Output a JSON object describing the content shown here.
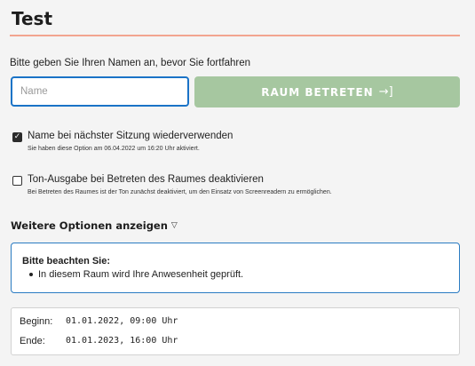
{
  "page": {
    "title": "Test",
    "intro": "Bitte geben Sie Ihren Namen an, bevor Sie fortfahren",
    "accent_color": "#f2a48f"
  },
  "name_input": {
    "placeholder": "Name",
    "value": ""
  },
  "enter_button": {
    "label": "RAUM BETRETEN",
    "icon": "login-arrow-icon",
    "color": "#a6c7a0"
  },
  "options": [
    {
      "label": "Name bei nächster Sitzung wiederverwenden",
      "hint": "Sie haben diese Option am 06.04.2022 um 16:20 Uhr aktiviert.",
      "checked": true
    },
    {
      "label": "Ton-Ausgabe bei Betreten des Raumes deaktivieren",
      "hint": "Bei Betreten des Raumes ist der Ton zunächst deaktiviert, um den Einsatz von Screenreadern zu ermöglichen.",
      "checked": false
    }
  ],
  "more_options": {
    "label": "Weitere Optionen anzeigen",
    "icon": "triangle-down-icon"
  },
  "notice": {
    "title": "Bitte beachten Sie:",
    "items": [
      "In diesem Raum wird Ihre Anwesenheit geprüft."
    ],
    "border_color": "#2a7bc2"
  },
  "schedule": {
    "begin_label": "Beginn:",
    "begin_value": "01.01.2022, 09:00 Uhr",
    "end_label": "Ende:",
    "end_value": "01.01.2023, 16:00 Uhr"
  }
}
